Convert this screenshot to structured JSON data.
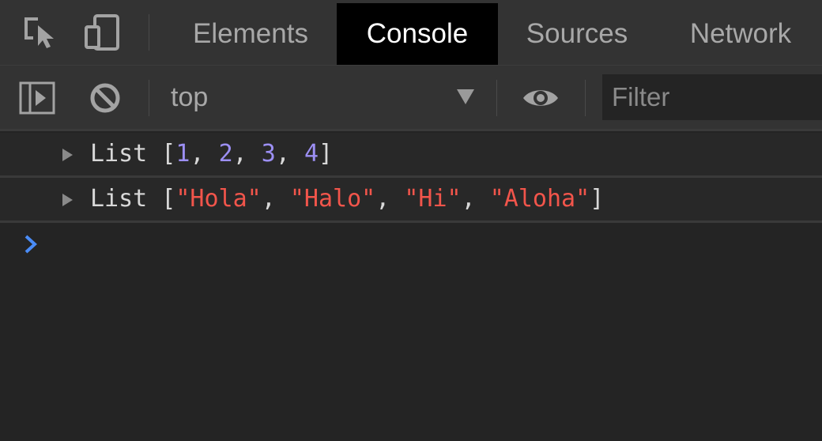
{
  "tabs": [
    {
      "label": "Elements",
      "active": false
    },
    {
      "label": "Console",
      "active": true
    },
    {
      "label": "Sources",
      "active": false
    },
    {
      "label": "Network",
      "active": false
    }
  ],
  "toolbar": {
    "context": "top",
    "filter_placeholder": "Filter"
  },
  "icons": {
    "inspect": "cursor-select-icon",
    "device": "device-toggle-icon",
    "sidebar": "sidebar-toggle-icon",
    "clear": "clear-console-icon",
    "live_expression": "eye-icon",
    "context_dropdown": "triangle-down-icon",
    "expand": "triangle-right-icon",
    "prompt": "chevron-right-icon"
  },
  "console": {
    "messages": [
      {
        "prefix": "List [",
        "items": [
          "1",
          "2",
          "3",
          "4"
        ],
        "item_type": "number",
        "separator": ", ",
        "suffix": "]"
      },
      {
        "prefix": "List [",
        "items": [
          "\"Hola\"",
          "\"Halo\"",
          "\"Hi\"",
          "\"Aloha\""
        ],
        "item_type": "string",
        "separator": ", ",
        "suffix": "]"
      }
    ]
  },
  "colors": {
    "background": "#242424",
    "toolbar": "#333333",
    "active_tab": "#000000",
    "number": "#9c8ff4",
    "string": "#f2554b",
    "prompt": "#4a8cf7"
  }
}
